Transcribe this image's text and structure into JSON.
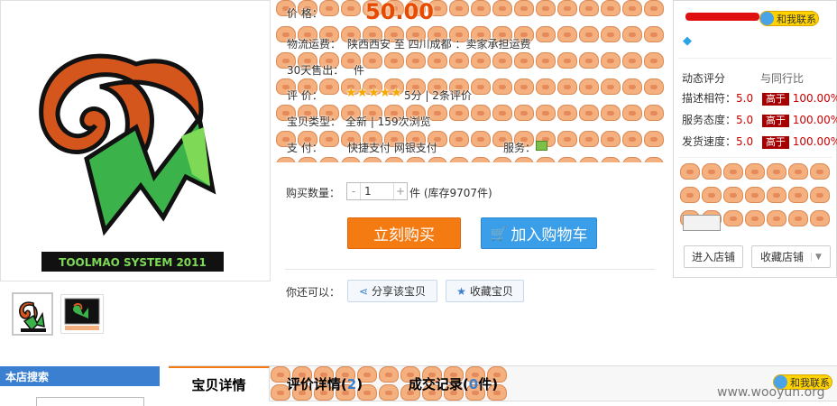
{
  "product": {
    "logo_text": "TOOLMAO SYSTEM 2011",
    "price_label": "价  格：",
    "price": "50.00",
    "shipping_label": "物流运费：",
    "shipping_value": "陕西西安 至 四川成都 ：卖家承担运费",
    "sales_label": "30天售出：",
    "sales_value": "件",
    "rating_label": "评  价：",
    "rating_value": "5分 | 2条评价",
    "rating_stars": 5,
    "type_label": "宝贝类型：",
    "type_value": "全新 | 159次浏览",
    "payment_label": "支  付：",
    "payment_value": "快捷支付  网银支付",
    "service_label": "服务：",
    "qty_label": "购买数量：",
    "qty_value": "1",
    "stock_text": "件 (库存9707件)",
    "buy_now": "立刻购买",
    "add_cart": "加入购物车",
    "you_can": "你还可以：",
    "share": "分享该宝贝",
    "favorite": "收藏宝贝"
  },
  "seller": {
    "contact_label": "和我联系",
    "dsr_title": "动态评分",
    "compare_title": "与同行比",
    "dsr": [
      {
        "name": "描述相符：",
        "score": "5.0",
        "level": "高于",
        "pct": "100.00%"
      },
      {
        "name": "服务态度：",
        "score": "5.0",
        "level": "高于",
        "pct": "100.00%"
      },
      {
        "name": "发货速度：",
        "score": "5.0",
        "level": "高于",
        "pct": "100.00%"
      }
    ],
    "enter_shop": "进入店铺",
    "fav_shop": "收藏店铺"
  },
  "tabs": {
    "store_search": "本店搜索",
    "detail": "宝贝详情",
    "reviews_prefix": "评价详情(",
    "reviews_count": "2",
    "reviews_suffix": ")",
    "deals_prefix": "成交记录(",
    "deals_count": "0",
    "deals_suffix": "件)",
    "contact": "和我联系"
  },
  "watermark": "www.wooyun.org"
}
